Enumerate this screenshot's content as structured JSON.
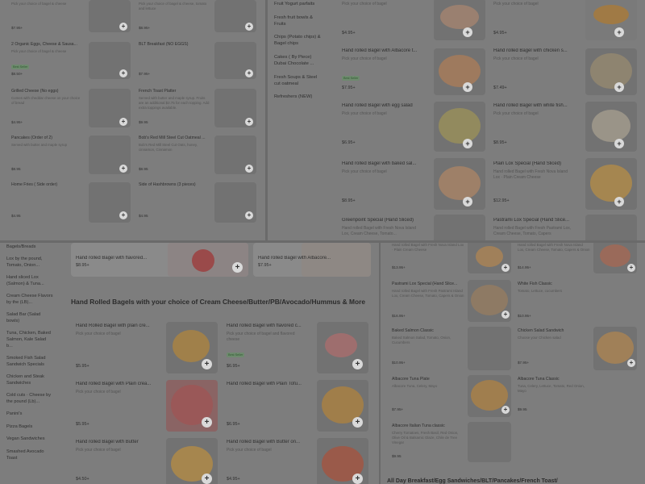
{
  "panel1": {
    "items": [
      {
        "title": "",
        "desc": "Pick your choice of bagel & cheese",
        "price": "$7.95+"
      },
      {
        "title": "",
        "desc": "Pick your choice of bagel & cheese, tomato and lettuce",
        "price": "$8.95+"
      },
      {
        "title": "2 Organic Eggs, Cheese & Sausa...",
        "desc": "Pick your choice of bagel & cheese",
        "badge": "Best Seller",
        "price": "$8.50+"
      },
      {
        "title": "BLT Breakfast (NO EGGS)",
        "desc": "",
        "price": "$7.95+"
      },
      {
        "title": "Grilled Cheese (No eggs)",
        "desc": "Comes with cheddar cheese on your choice of bread",
        "price": "$4.95+"
      },
      {
        "title": "French Toast Platter",
        "desc": "Served with butter and maple syrup. Fruits are an additional $2.75 for each topping. Add extra toppings available.",
        "price": "$9.95"
      },
      {
        "title": "Pancakes (Order of 2)",
        "desc": "Served with butter and maple syrup",
        "price": "$8.95"
      },
      {
        "title": "Bob's Red Mill Steel Cut Oatmeal ...",
        "desc": "Bob's Red Mill Steel Cut Oats, honey, cinnamon, Cinnamon",
        "price": "$8.95"
      },
      {
        "title": "Home Fries ( Side order)",
        "desc": "",
        "price": "$4.95"
      },
      {
        "title": "Side of Hashbrowns (3 pieces)",
        "desc": "",
        "price": "$4.95"
      }
    ]
  },
  "panel2": {
    "nav": [
      "Fruit Yogurt parfaits",
      "Fresh fruit bowls & Fruits",
      "Chips (Potato chips) & Bagel chips",
      "Cakes ( By Piece) Dubai Chocolate ...",
      "Fresh Soups & Steel cut oatmeal",
      "Refreshers (NEW)"
    ],
    "items": [
      {
        "title": "",
        "desc": "Pick your choice of bagel",
        "price": "$4.95+"
      },
      {
        "title": "",
        "desc": "Pick your choice of bagel",
        "price": "$4.95+"
      },
      {
        "title": "Hand rolled Bagel with Albacore t...",
        "desc": "Pick your choice of bagel",
        "badge": "Best Seller",
        "price": "$7.95+"
      },
      {
        "title": "Hand rolled Bagel with chicken s...",
        "desc": "Pick your choice of bagel",
        "price": "$7.49+"
      },
      {
        "title": "Hand rolled Bagel with egg salad",
        "desc": "Pick your choice of bagel",
        "price": "$6.95+"
      },
      {
        "title": "Hand rolled Bagel with white fish...",
        "desc": "Pick your choice of bagel",
        "price": "$8.95+"
      },
      {
        "title": "Hand rolled Bagel with baked sal...",
        "desc": "Pick your choice of bagel",
        "price": "$8.95+"
      },
      {
        "title": "Plain Lox Special (Hand Sliced)",
        "desc": "Hand rolled Bagel with Fresh Nova Island Lox · Plain Cream Cheese",
        "price": "$12.95+"
      },
      {
        "title": "Greenpoint Special (Hand Sliced)",
        "desc": "Hand rolled Bagel with Fresh Nova Island Lox, Cream Cheese, Tomato...",
        "price": ""
      },
      {
        "title": "Pastrami Lox Special (Hand Slice...",
        "desc": "Hand rolled Bagel with Fresh Pastrami Lox, Cream Cheese, Tomato, Capers",
        "price": ""
      }
    ]
  },
  "panel3": {
    "nav": [
      "Dry rolled Fresh Bagels/Breads",
      "Lox by the pound, Tomato, Onion...",
      "Hand sliced Lox (Salmon) & Tuna...",
      "Cream Cheese Flavors by the (LB)...",
      "Salad Bar (Salad bowls)",
      "Tuna, Chicken, Baked Salmon, Kale Salad b...",
      "Smoked Fish Salad Sandwich Specials",
      "Chicken and Steak Sandwiches",
      "Cold cuts · Cheese by the pound (Lb)...",
      "Panini's",
      "Pizza Bagels",
      "Vegan Sandwiches",
      "Smashed Avocado Toast"
    ],
    "top_cards": [
      {
        "title": "Hand rolled Bagel with flavored...",
        "price": "$8.95+"
      },
      {
        "title": "Hand rolled Bagel with Albacore...",
        "price": "$7.95+"
      }
    ],
    "section_title": "Hand Rolled Bagels with your choice of Cream Cheese/Butter/PB/Avocado/Hummus & More",
    "items": [
      {
        "title": "Hand Rolled Bagel with plain cre...",
        "desc": "Pick your choice of bagel",
        "price": "$5.95+"
      },
      {
        "title": "Hand rolled Bagel with flavored c...",
        "desc": "Pick your choice of bagel and flavored cheese",
        "badge": "Best Seller",
        "price": "$6.95+"
      },
      {
        "title": "Hand rolled Bagel with Plain crea...",
        "desc": "Pick your choice of bagel",
        "price": "$5.95+"
      },
      {
        "title": "Hand rolled Bagel with Plain Tofu...",
        "desc": "",
        "price": "$6.95+"
      },
      {
        "title": "Hand rolled Bagel with Butter",
        "desc": "Pick your choice of bagel",
        "price": "$4.50+"
      },
      {
        "title": "Hand rolled Bagel with Butter on...",
        "desc": "Pick your choice of bagel",
        "price": "$4.95+"
      }
    ]
  },
  "panel4": {
    "items": [
      {
        "title": "",
        "desc": "Hand rolled Bagel with Fresh Nova Island Lox · Plain Cream Cheese",
        "price": "$13.95+"
      },
      {
        "title": "",
        "desc": "Hand rolled Bagel with Fresh Nova Island Lox, Cream Cheese, Tomato, Capers & Onion",
        "price": "$14.95+"
      },
      {
        "title": "Pastrami Lox Special (Hand Slice...",
        "desc": "Hand rolled Bagel with Fresh Pastrami Island Lox, Cream Cheese, Tomato, Capers & Onion",
        "price": "$16.95+"
      },
      {
        "title": "White Fish Classic",
        "desc": "Tomato, Lettuce, cucumbers",
        "price": "$10.95+"
      },
      {
        "title": "Baked Salmon Classic",
        "desc": "Baked Salmon Salad, Tomato, Onion, Cucumbers",
        "price": "$10.95+"
      },
      {
        "title": "Chicken Salad Sandwich",
        "desc": "Choose your Chicken salad",
        "price": "$7.95+"
      },
      {
        "title": "Albacore Tuna Plate",
        "desc": "Albacore Tuna, Celery, Mayo",
        "price": "$7.95+"
      },
      {
        "title": "Albacore Tuna Classic",
        "desc": "Tuna, Celery, Lettuce, Tomato, Red Onion, Mayo",
        "price": "$9.95"
      },
      {
        "title": "Albacore Italian Tuna classic",
        "desc": "Cherry Tomatoes, Fresh Basil, Red Onion, Olive Oil & Balsamic Glaze, Chile de Tree Vinegar",
        "price": "$9.95"
      }
    ],
    "section_title": "All Day Breakfast/Egg Sandwiches/BLT/Pancakes/French Toast/"
  },
  "colors": {
    "overlay": "#7d7d7d",
    "thumb_bagel": "#a07a45",
    "thumb_salmon": "#b07a6a",
    "button": "#d9d9d9"
  }
}
